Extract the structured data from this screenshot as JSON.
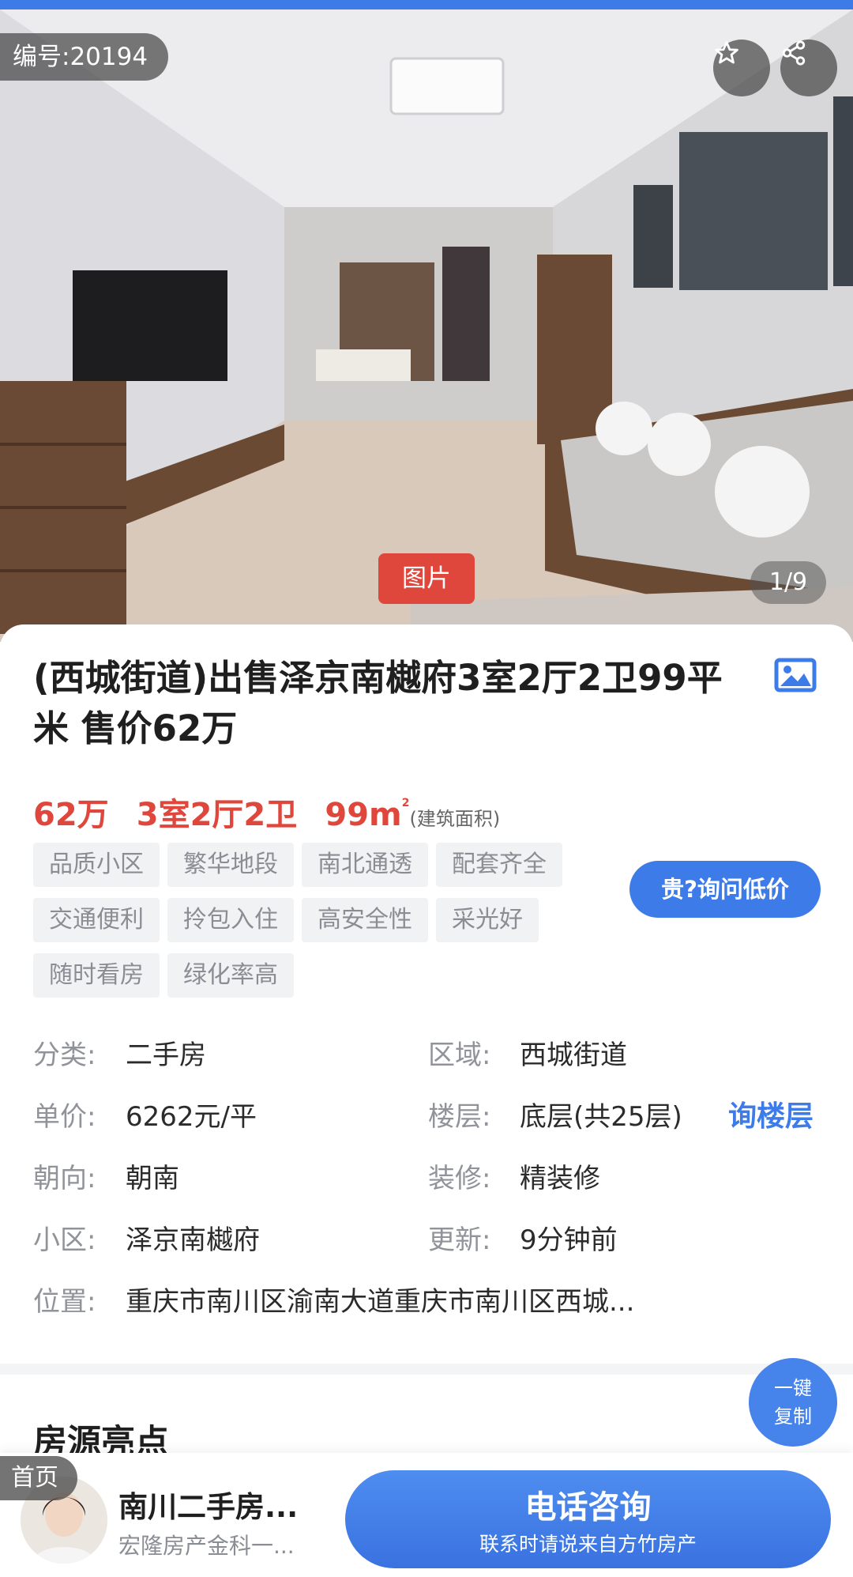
{
  "listing": {
    "id_label": "编号:20194",
    "image_tab": "图片",
    "image_counter": "1/9",
    "title": "(西城街道)出售泽京南樾府3室2厅2卫99平米 售价62万",
    "price": "62万",
    "layout": "3室2厅2卫",
    "area": "99m",
    "area_sup": "2",
    "area_note": "(建筑面积)",
    "tags": [
      "品质小区",
      "繁华地段",
      "南北通透",
      "配套齐全",
      "交通便利",
      "拎包入住",
      "高安全性",
      "采光好",
      "随时看房",
      "绿化率高"
    ],
    "ask_price_button": "贵?询问低价"
  },
  "info": {
    "category_label": "分类:",
    "category_value": "二手房",
    "region_label": "区域:",
    "region_value": "西城街道",
    "unit_price_label": "单价:",
    "unit_price_value": "6262元/平",
    "floor_label": "楼层:",
    "floor_value": "底层(共25层)",
    "ask_floor_link": "询楼层",
    "orientation_label": "朝向:",
    "orientation_value": "朝南",
    "decoration_label": "装修:",
    "decoration_value": "精装修",
    "community_label": "小区:",
    "community_value": "泽京南樾府",
    "updated_label": "更新:",
    "updated_value": "9分钟前",
    "location_label": "位置:",
    "location_value": "重庆市南川区渝南大道重庆市南川区西城..."
  },
  "highlights": {
    "title": "房源亮点",
    "copy_button_line1": "一键",
    "copy_button_line2": "复制"
  },
  "bottom_bar": {
    "home_label": "首页",
    "agent_name": "南川二手房...",
    "agent_company": "宏隆房产金科一...",
    "call_main": "电话咨询",
    "call_sub": "联系时请说来自方竹房产"
  },
  "icons": {
    "favorite": "star-icon",
    "share": "share-icon",
    "gallery": "image-gallery-icon"
  },
  "colors": {
    "accent_blue": "#3d7ce8",
    "price_red": "#e0473c",
    "tag_bg": "#f1f2f4"
  }
}
